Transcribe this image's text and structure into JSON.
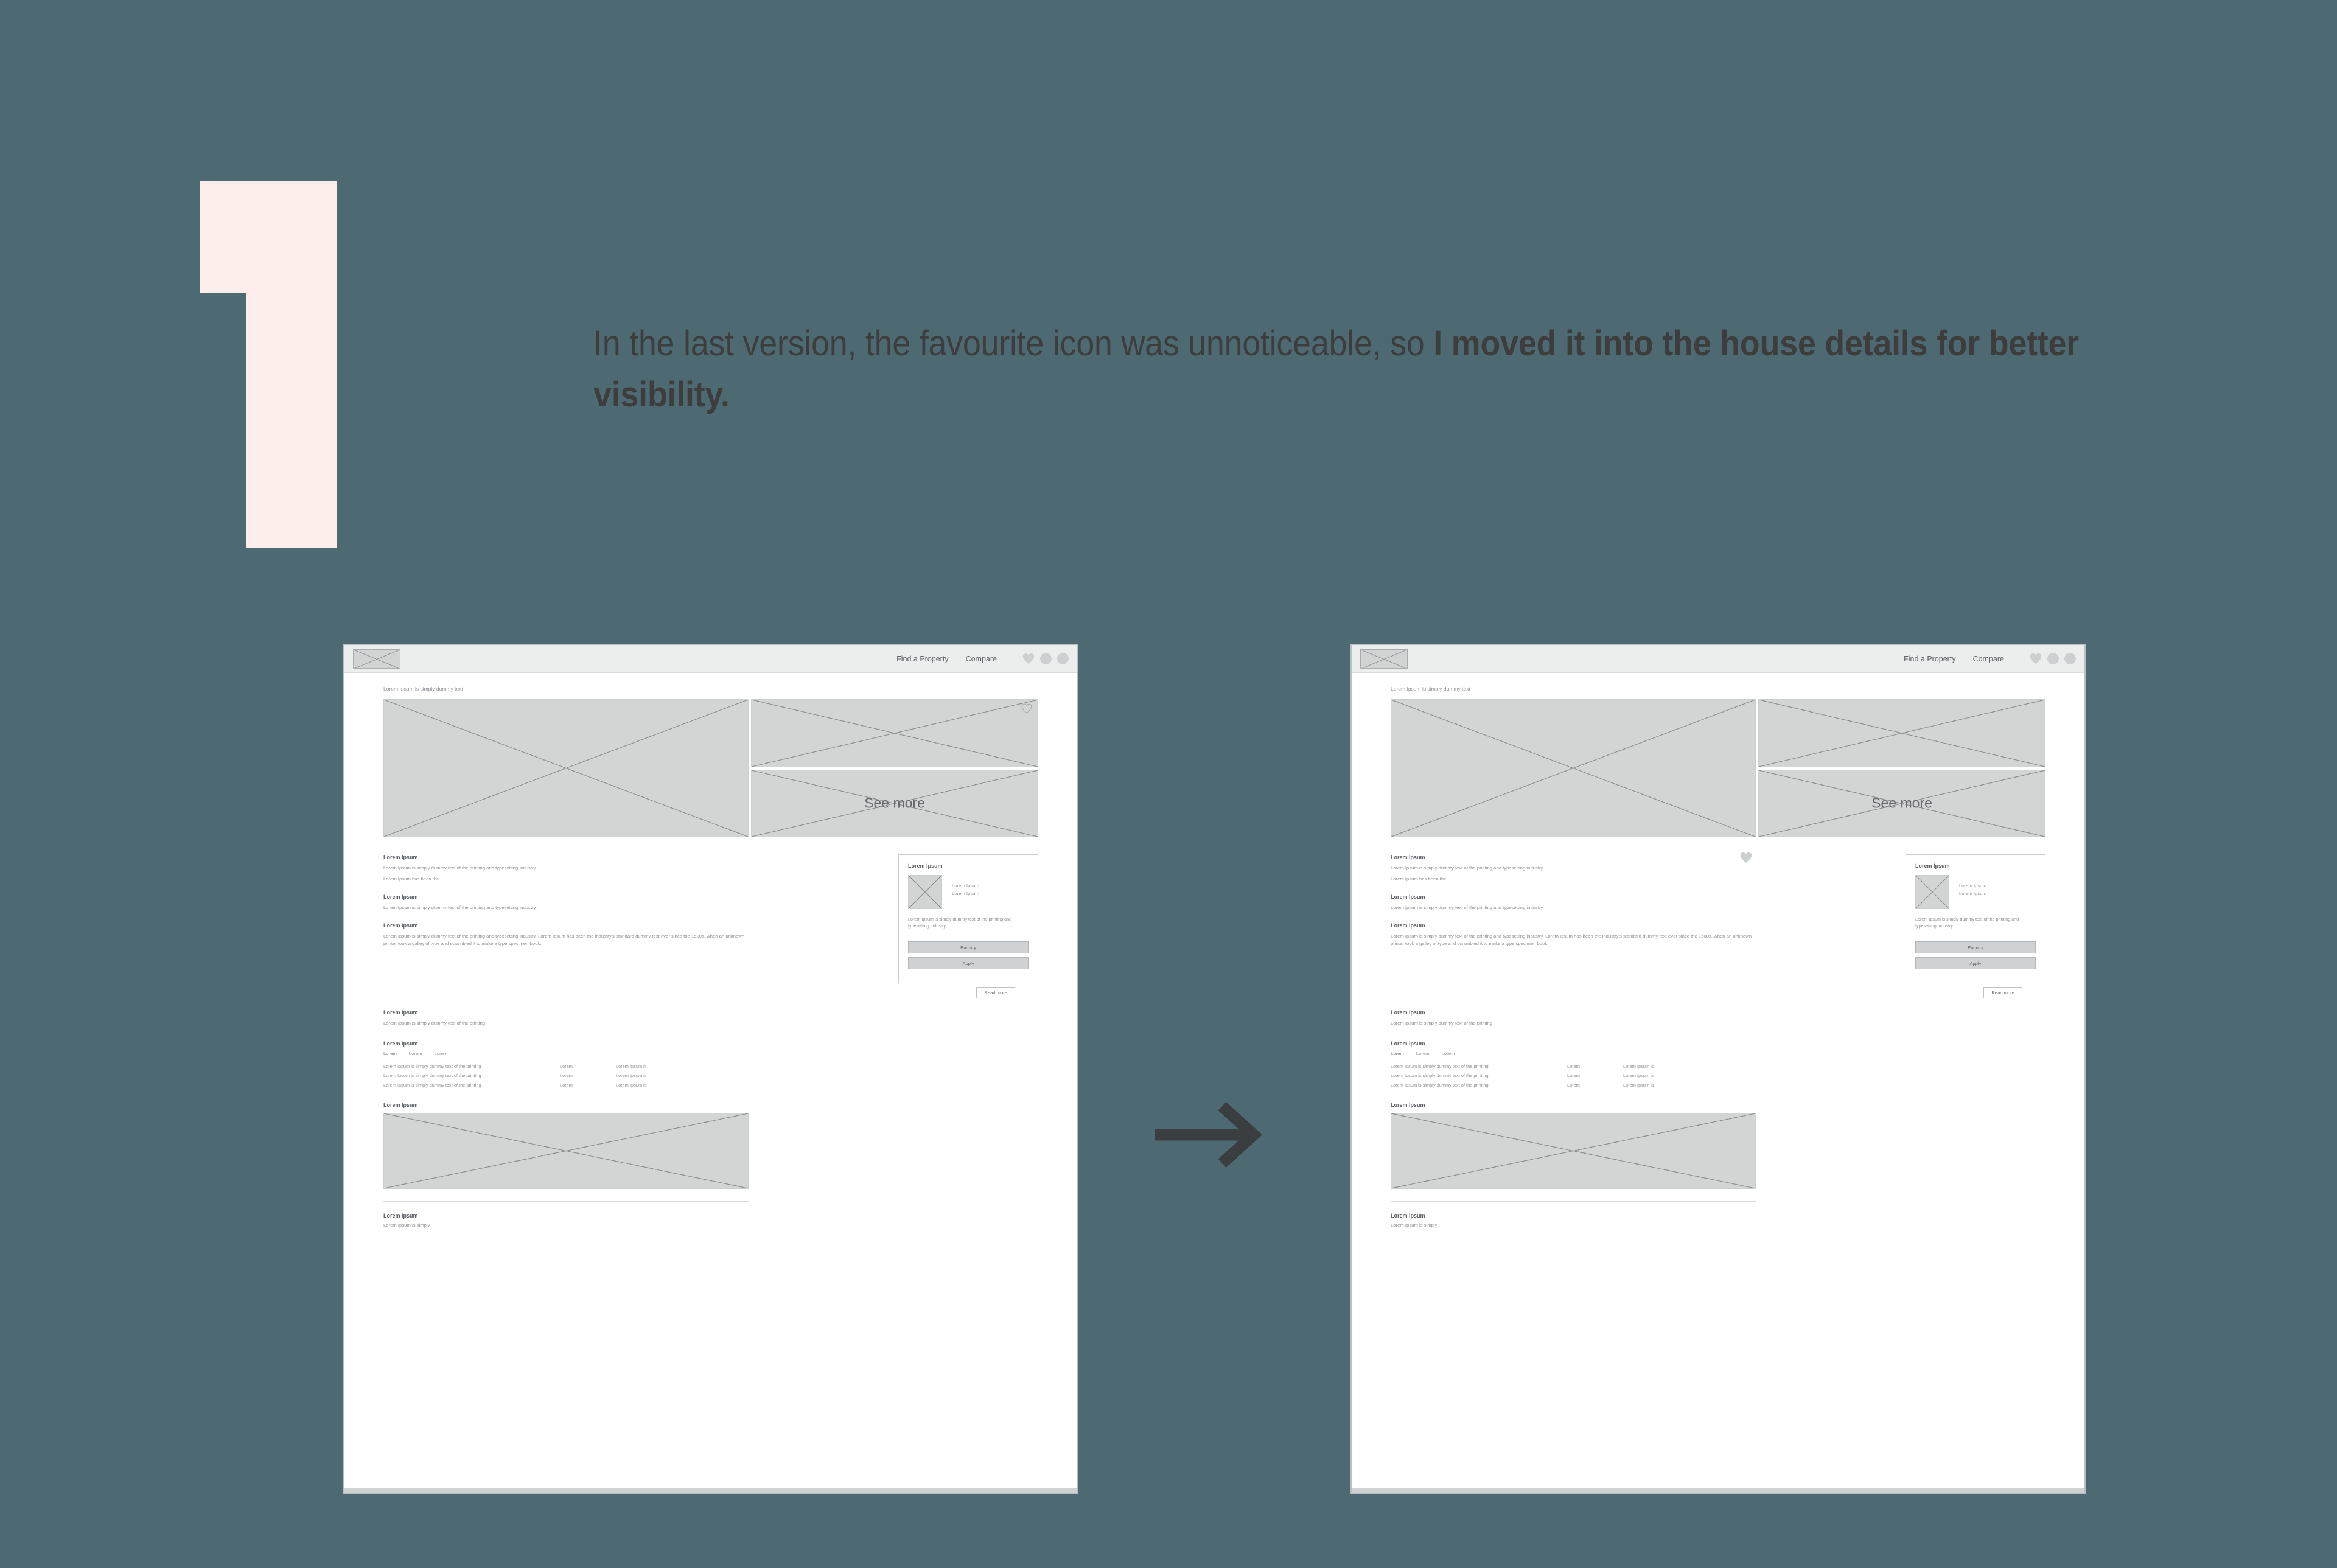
{
  "background_color": "#4d6a72",
  "numeral": {
    "value": "1",
    "color": "#fdeeec"
  },
  "headline": {
    "normal_text": "In the last version, the favourite icon was unnoticeable, so ",
    "bold_text": "I moved it into the house details for better visibility.",
    "color": "#3d3d3d"
  },
  "arrow": {
    "name": "right-arrow",
    "color": "#3a3e40"
  },
  "wireframes": [
    {
      "id": "before",
      "header": {
        "logo": "logo-placeholder",
        "nav_links": [
          "Find a Property",
          "Compare"
        ],
        "icons": [
          "heart-icon",
          "circle-icon",
          "circle-icon"
        ]
      },
      "breadcrumb": "Lorem Ipsum is simply dummy text",
      "gallery": {
        "main_image": "image-placeholder",
        "side_top_image": "image-placeholder",
        "side_bottom_label": "See more",
        "favourite_heart_location": "gallery"
      },
      "sections": [
        {
          "title": "Lorem Ipsum",
          "paragraphs": [
            "Lorem Ipsum is simply dummy text of the printing and typesetting industry.",
            "Lorem Ipsum has been the"
          ]
        },
        {
          "title": "Lorem Ipsum",
          "paragraphs": [
            "Lorem Ipsum is simply dummy text of the printing and typesetting industry."
          ]
        },
        {
          "title": "Lorem Ipsum",
          "paragraphs": [
            "Lorem Ipsum is simply dummy text of the printing and typesetting industry. Lorem Ipsum has been the industry's standard dummy text ever since the 1500s, when an unknown printer took a galley of type and scrambled it to make a type specimen book."
          ]
        }
      ],
      "card": {
        "title": "Lorem Ipsum",
        "thumb": "image-placeholder",
        "lines": [
          "Lorem Ipsum",
          "Lorem Ipsum"
        ],
        "description": "Lorem Ipsum is simply dummy text of the printing and typesetting industry.",
        "buttons": [
          "Enquiry",
          "Apply"
        ],
        "favourite_heart": false
      },
      "read_more_label": "Read more",
      "lower_section": {
        "title": "Lorem Ipsum",
        "paragraph": "Lorem Ipsum is simply dummy text of the printing"
      },
      "table_section": {
        "title": "Lorem Ipsum",
        "tabs": [
          "Lorem",
          "Lorem",
          "Lorem"
        ],
        "active_tab_index": 0,
        "rows": [
          [
            "Lorem Ipsum is simply dummy text of the printing",
            "Lorem",
            "Lorem Ipsum is"
          ],
          [
            "Lorem Ipsum is simply dummy text of the printing",
            "Lorem",
            "Lorem Ipsum is"
          ],
          [
            "Lorem Ipsum is simply dummy text of the printing",
            "Lorem",
            "Lorem Ipsum is"
          ]
        ]
      },
      "media_section": {
        "title": "Lorem Ipsum",
        "image": "image-placeholder"
      },
      "footer": {
        "title": "Lorem Ipsum",
        "subtitle": "Lorem Ipsum is simply"
      }
    },
    {
      "id": "after",
      "header": {
        "logo": "logo-placeholder",
        "nav_links": [
          "Find a Property",
          "Compare"
        ],
        "icons": [
          "heart-icon",
          "circle-icon",
          "circle-icon"
        ]
      },
      "breadcrumb": "Lorem Ipsum is simply dummy text",
      "gallery": {
        "main_image": "image-placeholder",
        "side_top_image": "image-placeholder",
        "side_bottom_label": "See more",
        "favourite_heart_location": "details"
      },
      "sections": [
        {
          "title": "Lorem Ipsum",
          "paragraphs": [
            "Lorem Ipsum is simply dummy text of the printing and typesetting industry.",
            "Lorem Ipsum has been the"
          ]
        },
        {
          "title": "Lorem Ipsum",
          "paragraphs": [
            "Lorem Ipsum is simply dummy text of the printing and typesetting industry."
          ]
        },
        {
          "title": "Lorem Ipsum",
          "paragraphs": [
            "Lorem Ipsum is simply dummy text of the printing and typesetting industry. Lorem Ipsum has been the industry's standard dummy text ever since the 1500s, when an unknown printer took a galley of type and scrambled it to make a type specimen book."
          ]
        }
      ],
      "card": {
        "title": "Lorem Ipsum",
        "thumb": "image-placeholder",
        "lines": [
          "Lorem Ipsum",
          "Lorem Ipsum"
        ],
        "description": "Lorem Ipsum is simply dummy text of the printing and typesetting industry.",
        "buttons": [
          "Enquiry",
          "Apply"
        ],
        "favourite_heart": true
      },
      "read_more_label": "Read more",
      "lower_section": {
        "title": "Lorem Ipsum",
        "paragraph": "Lorem Ipsum is simply dummy text of the printing"
      },
      "table_section": {
        "title": "Lorem Ipsum",
        "tabs": [
          "Lorem",
          "Lorem",
          "Lorem"
        ],
        "active_tab_index": 0,
        "rows": [
          [
            "Lorem Ipsum is simply dummy text of the printing",
            "Lorem",
            "Lorem Ipsum is"
          ],
          [
            "Lorem Ipsum is simply dummy text of the printing",
            "Lorem",
            "Lorem Ipsum is"
          ],
          [
            "Lorem Ipsum is simply dummy text of the printing",
            "Lorem",
            "Lorem Ipsum is"
          ]
        ]
      },
      "media_section": {
        "title": "Lorem Ipsum",
        "image": "image-placeholder"
      },
      "footer": {
        "title": "Lorem Ipsum",
        "subtitle": "Lorem Ipsum is simply"
      }
    }
  ]
}
